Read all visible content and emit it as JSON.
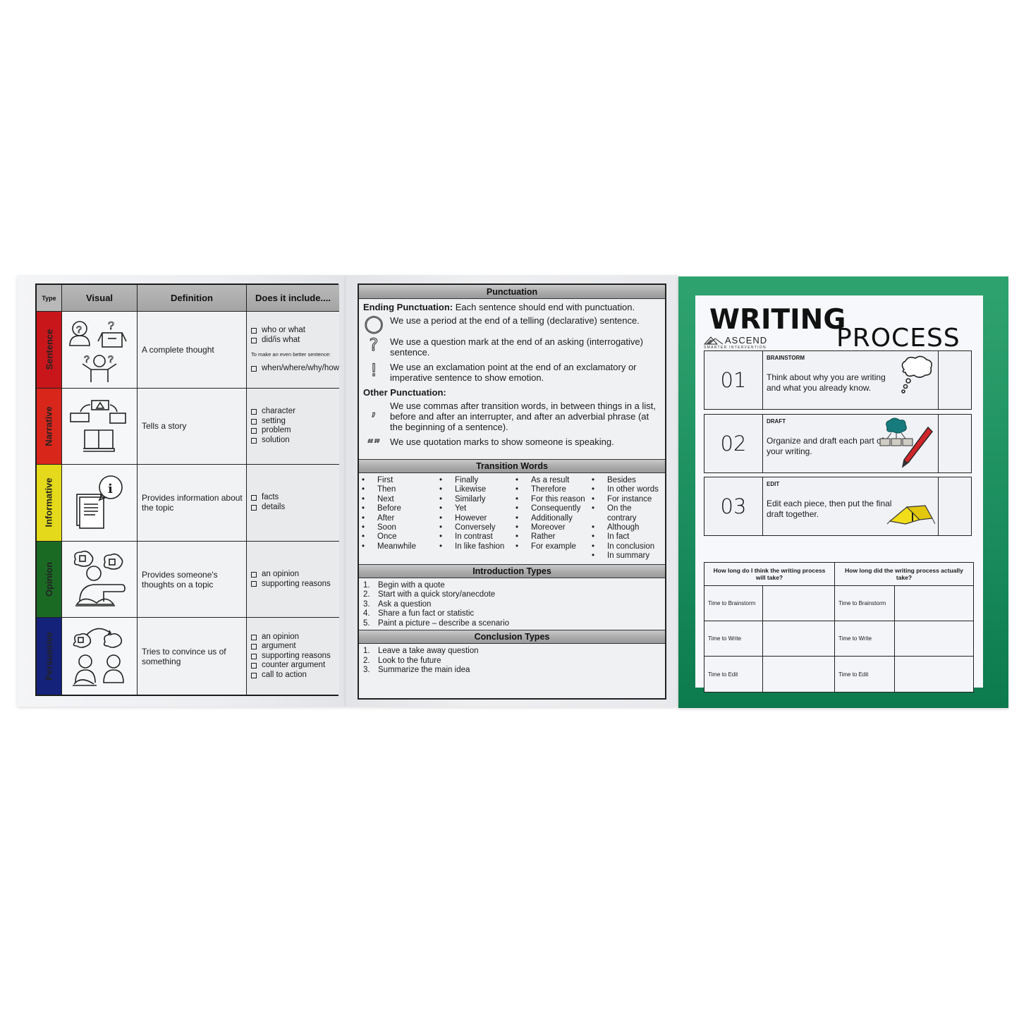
{
  "left_panel": {
    "headers": {
      "type": "Type",
      "visual": "Visual",
      "definition": "Definition",
      "includes": "Does it include...."
    },
    "rows": [
      {
        "type": "Sentence",
        "color": "#c8161b",
        "visual_icon": "confused-person-and-question-box-icon",
        "definition": "A complete thought",
        "includes": [
          "who or what",
          "did/is what"
        ],
        "note": "To make an even better sentence:",
        "extra_includes": [
          "when/where/why/how"
        ]
      },
      {
        "type": "Narrative",
        "color": "#d9261b",
        "visual_icon": "story-sequence-book-icon",
        "definition": "Tells a story",
        "includes": [
          "character",
          "setting",
          "problem",
          "solution"
        ]
      },
      {
        "type": "Informative",
        "color": "#e4d91a",
        "visual_icon": "document-info-icon",
        "definition": "Provides information about the topic",
        "includes": [
          "facts",
          "details"
        ]
      },
      {
        "type": "Opinion",
        "color": "#1b6a24",
        "visual_icon": "thumbs-thought-person-icon",
        "definition": "Provides someone's thoughts on a topic",
        "includes": [
          "an opinion",
          "supporting reasons"
        ]
      },
      {
        "type": "Persuasive",
        "color": "#15227a",
        "visual_icon": "two-people-convince-icon",
        "definition": "Tries to convince us of something",
        "includes": [
          "an opinion",
          "argument",
          "supporting reasons",
          "counter argument",
          "call to action"
        ]
      }
    ]
  },
  "middle_panel": {
    "punctuation": {
      "title": "Punctuation",
      "ending_label": "Ending Punctuation:",
      "ending_text": " Each sentence should end with punctuation.",
      "ending_items": [
        {
          "glyph": "period",
          "text": "We use a period at the end of a telling (declarative) sentence."
        },
        {
          "glyph": "question-mark",
          "text": "We use a question mark at the end of an asking (interrogative) sentence."
        },
        {
          "glyph": "exclamation-point",
          "text": "We use an exclamation point at the end of an exclamatory or imperative sentence to show emotion."
        }
      ],
      "other_label": "Other Punctuation:",
      "other_items": [
        {
          "glyph": "comma",
          "text": "We use commas after transition words, in between things in a list, before and after an interrupter, and after an adverbial phrase (at the beginning of a sentence)."
        },
        {
          "glyph": "quotation-marks",
          "text": "We use quotation marks to show someone is speaking."
        }
      ]
    },
    "transition_words": {
      "title": "Transition Words",
      "columns": [
        [
          "First",
          "Then",
          "Next",
          "Before",
          "After",
          "Soon",
          "Once",
          "Meanwhile"
        ],
        [
          "Finally",
          "Likewise",
          "Similarly",
          "Yet",
          "However",
          "Conversely",
          "In contrast",
          "In like fashion"
        ],
        [
          "As a result",
          "Therefore",
          "For this reason",
          "Consequently",
          "Additionally",
          "Moreover",
          "Rather",
          "For example"
        ],
        [
          "Besides",
          "In other words",
          "For instance",
          "On the contrary",
          "Although",
          "In fact",
          "In conclusion",
          "In summary"
        ]
      ]
    },
    "introduction_types": {
      "title": "Introduction Types",
      "items": [
        "Begin with a quote",
        "Start with a quick story/anecdote",
        "Ask a question",
        "Share a fun fact or statistic",
        "Paint a picture – describe a scenario"
      ]
    },
    "conclusion_types": {
      "title": "Conclusion Types",
      "items": [
        "Leave a take away question",
        "Look to the future",
        "Summarize the main idea"
      ]
    }
  },
  "right_panel": {
    "title_line1": "WRITING",
    "title_line2": "PROCESS",
    "logo": {
      "name": "ASCEND",
      "tagline": "SMARTER INTERVENTION"
    },
    "border_color": "#16885a",
    "steps": [
      {
        "number": "01",
        "title": "BRAINSTORM",
        "text": "Think about why you are writing and what you already know.",
        "icon": "thought-cloud-icon"
      },
      {
        "number": "02",
        "title": "DRAFT",
        "text": "Organize and draft each part of your writing.",
        "icon": "organizer-and-pencil-icon"
      },
      {
        "number": "03",
        "title": "EDIT",
        "text": "Edit each piece, then put the final draft together.",
        "icon": "tent-icon"
      }
    ],
    "time_table": {
      "estimate_header": "How long do I think the writing process will take?",
      "actual_header": "How long did the writing process actually take?",
      "rows": [
        "Time to Brainstorm",
        "Time to Write",
        "Time to Edit"
      ]
    }
  }
}
